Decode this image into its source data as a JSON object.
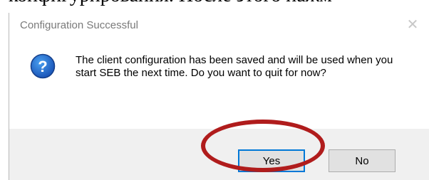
{
  "background": {
    "text": "конфигурирования. После этого нажм"
  },
  "dialog": {
    "title": "Configuration Successful",
    "close_glyph": "✕",
    "icon": "question-icon",
    "message": "The client configuration has been saved and will be used when you start SEB the next time. Do you want to quit for now?",
    "buttons": {
      "yes_label": "Yes",
      "no_label": "No"
    }
  },
  "annotation": {
    "highlight_color": "#b01c1c",
    "target": "yes-button"
  }
}
